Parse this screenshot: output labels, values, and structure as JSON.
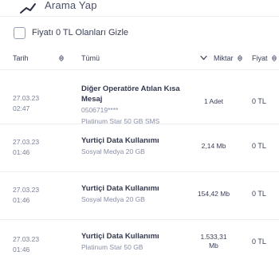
{
  "search": {
    "label": "Arama Yap",
    "icon": "search-icon"
  },
  "filter": {
    "label": "Fiyatı 0 TL Olanları Gizle"
  },
  "header": {
    "date": "Tarih",
    "type_select": "Tümü",
    "amount": "Miktar",
    "price": "Fiyat"
  },
  "rows": [
    {
      "date": "27.03.23",
      "time": "02:47",
      "title": "Diğer Operatöre Atılan Kısa Mesaj",
      "line2": "0506719****",
      "line3": "Platinum Star 50 GB SMS",
      "amount": "1 Adet",
      "price": "0 TL"
    },
    {
      "date": "27.03.23",
      "time": "01:46",
      "title": "Yurtiçi Data Kullanımı",
      "line2": "Sosyal Medya 20 GB",
      "amount": "2,14 Mb",
      "price": "0 TL"
    },
    {
      "date": "27.03.23",
      "time": "01:46",
      "title": "Yurtiçi Data Kullanımı",
      "line2": "Sosyal Medya 20 GB",
      "amount": "154,42 Mb",
      "price": "0 TL"
    },
    {
      "date": "27.03.23",
      "time": "01:46",
      "title": "Yurtiçi Data Kullanımı",
      "line2": "Platinum Star 50 GB",
      "amount_value": "1.533,31",
      "amount_unit": "Mb",
      "price": "0 TL"
    }
  ]
}
